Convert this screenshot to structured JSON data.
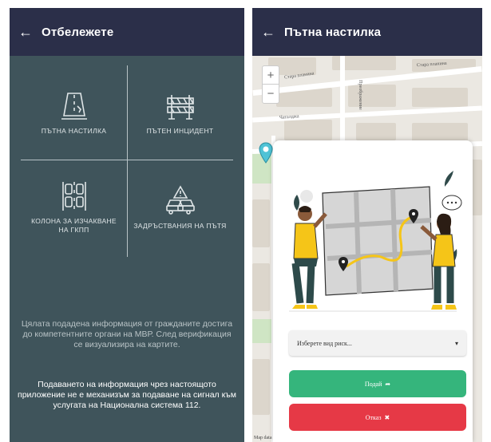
{
  "left_screen": {
    "header": {
      "back_icon": "arrow-left-icon",
      "title": "Отбележете"
    },
    "categories": [
      {
        "label": "ПЪТНА НАСТИЛКА",
        "icon": "road-surface-icon"
      },
      {
        "label": "ПЪТЕН ИНЦИДЕНТ",
        "icon": "road-barrier-icon"
      },
      {
        "label": "КОЛОНА ЗА ИЗЧАКВАНЕ НА ГКПП",
        "icon": "traffic-queue-icon"
      },
      {
        "label": "ЗАДРЪСТВАНИЯ НА ПЪТЯ",
        "icon": "traffic-jam-icon"
      }
    ],
    "info_text": "Цялата подадена информация от гражданите достига до компетентните органи на МВР. След верификация се визуализира на картите.",
    "disclaimer_text": "Подаването на информация чрез настоящото приложение не е механизъм за подаване на сигнал към услугата на Национална система 112."
  },
  "right_screen": {
    "header": {
      "back_icon": "arrow-left-icon",
      "title": "Пътна настилка"
    },
    "map": {
      "streets": [
        "Стара планина",
        "Стара планина",
        "Чаталджа",
        "Преображение"
      ],
      "zoom_in": "+",
      "zoom_out": "−",
      "attribution": "Map data"
    },
    "modal": {
      "select_placeholder": "Изберете вид риск...",
      "submit_label": "Подай",
      "cancel_label": "Отказ"
    }
  },
  "colors": {
    "header_bg": "#2b2f49",
    "left_bg": "#3f545b",
    "submit": "#35b57c",
    "cancel": "#e63946"
  }
}
